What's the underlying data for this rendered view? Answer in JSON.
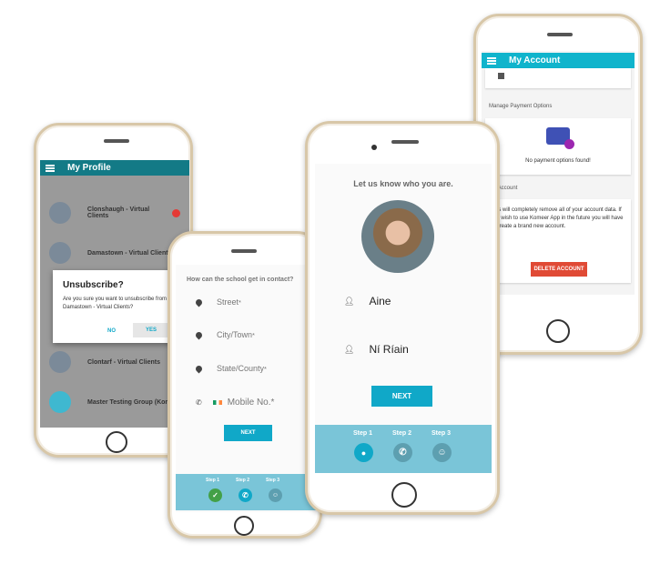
{
  "profile": {
    "title": "My Profile",
    "items": [
      "Clonshaugh - Virtual Clients",
      "Damastown - Virtual Clients",
      "Clontarf - Virtual Clients",
      "Master Testing Group (Kome..."
    ],
    "dialog": {
      "title": "Unsubscribe?",
      "message": "Are you sure you want to unsubscribe from Damastown - Virtual Clients?",
      "no": "NO",
      "yes": "YES"
    }
  },
  "contact": {
    "heading": "How can the school get in contact?",
    "street": "Street",
    "city": "City/Town",
    "state": "State/County",
    "mobile": "Mobile No.",
    "required": "*",
    "next": "NEXT",
    "steps": [
      "Step 1",
      "Step 2",
      "Step 3"
    ]
  },
  "who": {
    "heading": "Let us know who you are.",
    "first_name": "Aine",
    "last_name": "Ní Ríain",
    "next": "NEXT",
    "steps": [
      "Step 1",
      "Step 2",
      "Step 3"
    ]
  },
  "account": {
    "title": "My Account",
    "payment_heading": "Manage Payment Options",
    "no_payment": "No payment options found!",
    "delete_heading": "ete Account",
    "delete_text": "This will completely remove all of your account data. If you wish to use Komeer App in the future you will have to create a brand new account.",
    "delete_button": "DELETE ACCOUNT"
  },
  "colors": {
    "teal": "#10a8c8",
    "profile_bar": "#137a86",
    "danger": "#e53935",
    "steps_bg": "#7ac5d8",
    "success": "#43a047"
  }
}
